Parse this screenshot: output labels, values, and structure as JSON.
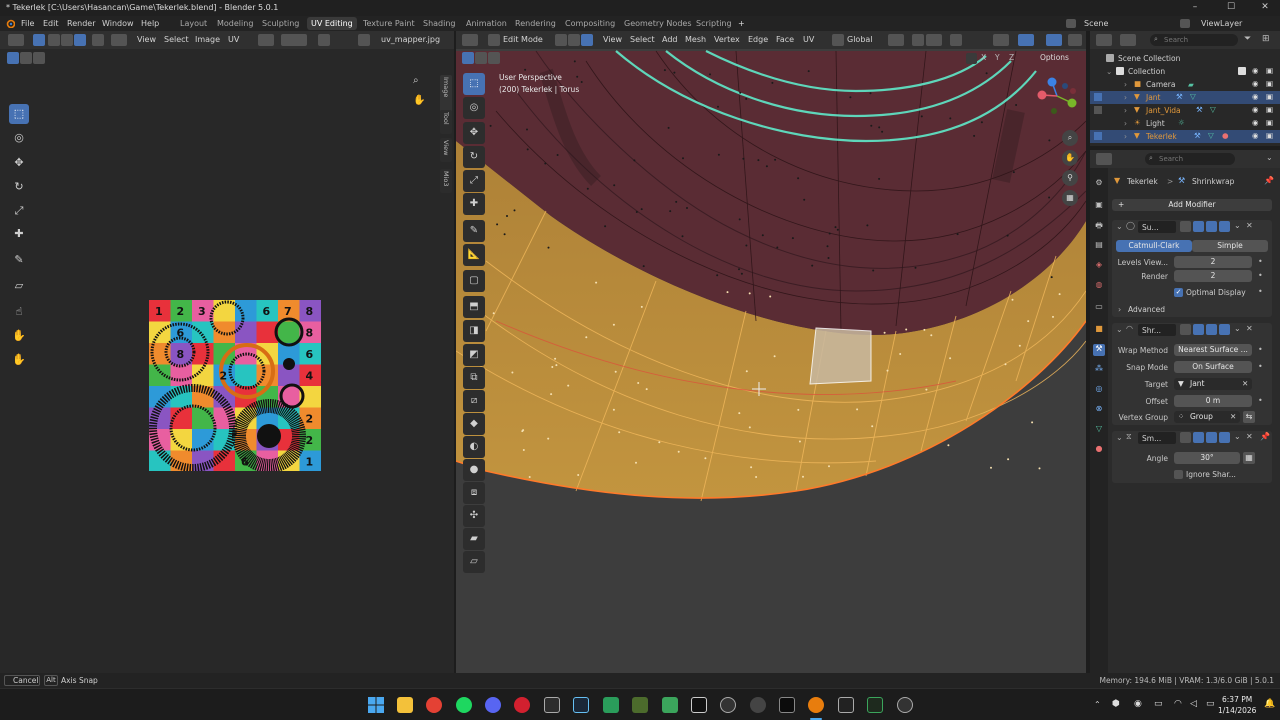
{
  "window": {
    "title": "* Tekerlek [C:\\Users\\Hasancan\\Game\\Tekerlek.blend] - Blender 5.0.1",
    "minimize": "–",
    "maximize": "☐",
    "close": "✕"
  },
  "menu": {
    "file": "File",
    "edit": "Edit",
    "render": "Render",
    "window": "Window",
    "help": "Help",
    "workspaces": [
      "Layout",
      "Modeling",
      "Sculpting",
      "UV Editing",
      "Texture Paint",
      "Shading",
      "Animation",
      "Rendering",
      "Compositing",
      "Geometry Nodes",
      "Scripting"
    ],
    "add_workspace": "+",
    "scene": "Scene",
    "view_layer": "ViewLayer"
  },
  "uv_editor": {
    "header": {
      "view": "View",
      "select": "Select",
      "image": "Image",
      "uv": "UV",
      "image_name": "uv_mapper.jpg"
    },
    "side_tabs": [
      "Image",
      "Tool",
      "View",
      "Mio3"
    ],
    "texture_numbers": [
      "1",
      "2",
      "3",
      "4",
      "5",
      "6",
      "7",
      "8"
    ]
  },
  "viewport": {
    "header": {
      "mode": "Edit Mode",
      "view": "View",
      "select": "Select",
      "add": "Add",
      "mesh": "Mesh",
      "vertex": "Vertex",
      "edge": "Edge",
      "face": "Face",
      "uv": "UV",
      "orientation": "Global"
    },
    "overlay_text": {
      "perspective": "User Perspective",
      "object_info": "(200) Tekerlek | Torus"
    },
    "options": "Options",
    "axes": {
      "x": "X",
      "y": "Y",
      "z": "Z"
    }
  },
  "outliner": {
    "search_placeholder": "Search",
    "items": [
      {
        "name": "Scene Collection",
        "depth": 0
      },
      {
        "name": "Collection",
        "depth": 1
      },
      {
        "name": "Camera",
        "depth": 2
      },
      {
        "name": "Jant",
        "depth": 2
      },
      {
        "name": "Jant_Vida",
        "depth": 2
      },
      {
        "name": "Light",
        "depth": 2
      },
      {
        "name": "Tekerlek",
        "depth": 2
      }
    ]
  },
  "properties": {
    "search_placeholder": "Search",
    "breadcrumb": {
      "object": "Tekerlek",
      "separator": ">",
      "modifier": "Shrinkwrap"
    },
    "add_modifier": "Add Modifier",
    "subsurf": {
      "name": "Su...",
      "catmull_clark": "Catmull-Clark",
      "simple": "Simple",
      "levels_viewport_label": "Levels View...",
      "levels_viewport": "2",
      "render_label": "Render",
      "render": "2",
      "optimal_display": "Optimal Display",
      "advanced": "Advanced"
    },
    "shrinkwrap": {
      "name": "Shr...",
      "wrap_method_label": "Wrap Method",
      "wrap_method": "Nearest Surface ...",
      "snap_mode_label": "Snap Mode",
      "snap_mode": "On Surface",
      "target_label": "Target",
      "target": "Jant",
      "offset_label": "Offset",
      "offset": "0 m",
      "vertex_group_label": "Vertex Group",
      "vertex_group": "Group"
    },
    "smooth": {
      "name": "Sm...",
      "angle_label": "Angle",
      "angle": "30°",
      "ignore_sharp": "Ignore Shar..."
    }
  },
  "status": {
    "cancel_key": "Cancel",
    "alt_key": "Alt",
    "axis_snap": "Axis Snap",
    "memory": "Memory: 194.6 MiB | VRAM: 1.3/6.0 GiB | 5.0.1"
  },
  "taskbar": {
    "time": "6:37 PM",
    "date": "1/14/2026"
  },
  "colors": {
    "accent": "#4772b3",
    "selected_row": "#334b75",
    "mesh_orange": "#d9a646",
    "mesh_dark_red": "#5a2c34"
  }
}
